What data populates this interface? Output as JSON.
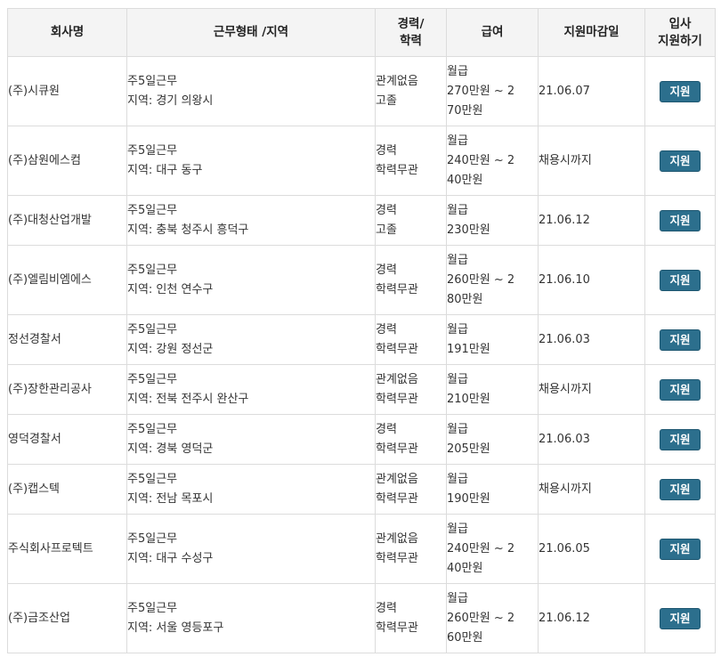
{
  "header": {
    "company": "회사명",
    "work": "근무형태 /지역",
    "career_line1": "경력/",
    "career_line2": "학력",
    "salary": "급여",
    "deadline": "지원마감일",
    "apply_line1": "입사",
    "apply_line2": "지원하기"
  },
  "apply_label": "지원",
  "rows": [
    {
      "company": "(주)시큐원",
      "work": "주5일근무",
      "region": "지역: 경기 의왕시",
      "career": "관계없음",
      "edu": "고졸",
      "salary": [
        "월급",
        "270만원 ~ 2",
        "70만원"
      ],
      "deadline": "21.06.07"
    },
    {
      "company": "(주)삼원에스컴",
      "work": "주5일근무",
      "region": "지역: 대구 동구",
      "career": "경력",
      "edu": "학력무관",
      "salary": [
        "월급",
        "240만원 ~ 2",
        "40만원"
      ],
      "deadline": "채용시까지"
    },
    {
      "company": "(주)대청산업개발",
      "work": "주5일근무",
      "region": "지역: 충북 청주시 흥덕구",
      "career": "경력",
      "edu": "고졸",
      "salary": [
        "월급",
        "230만원"
      ],
      "deadline": "21.06.12"
    },
    {
      "company": "(주)엘림비엠에스",
      "work": "주5일근무",
      "region": "지역: 인천 연수구",
      "career": "경력",
      "edu": "학력무관",
      "salary": [
        "월급",
        "260만원 ~ 2",
        "80만원"
      ],
      "deadline": "21.06.10"
    },
    {
      "company": "정선경찰서",
      "work": "주5일근무",
      "region": "지역: 강원 정선군",
      "career": "경력",
      "edu": "학력무관",
      "salary": [
        "월급",
        "191만원"
      ],
      "deadline": "21.06.03"
    },
    {
      "company": "(주)장한관리공사",
      "work": "주5일근무",
      "region": "지역: 전북 전주시 완산구",
      "career": "관계없음",
      "edu": "학력무관",
      "salary": [
        "월급",
        "210만원"
      ],
      "deadline": "채용시까지"
    },
    {
      "company": "영덕경찰서",
      "work": "주5일근무",
      "region": "지역: 경북 영덕군",
      "career": "경력",
      "edu": "학력무관",
      "salary": [
        "월급",
        "205만원"
      ],
      "deadline": "21.06.03"
    },
    {
      "company": "(주)캡스텍",
      "work": "주5일근무",
      "region": "지역: 전남 목포시",
      "career": "관계없음",
      "edu": "학력무관",
      "salary": [
        "월급",
        "190만원"
      ],
      "deadline": "채용시까지"
    },
    {
      "company": "주식회사프로텍트",
      "work": "주5일근무",
      "region": "지역: 대구 수성구",
      "career": "관계없음",
      "edu": "학력무관",
      "salary": [
        "월급",
        "240만원 ~ 2",
        "40만원"
      ],
      "deadline": "21.06.05"
    },
    {
      "company": "(주)금조산업",
      "work": "주5일근무",
      "region": "지역: 서울 영등포구",
      "career": "경력",
      "edu": "학력무관",
      "salary": [
        "월급",
        "260만원 ~ 2",
        "60만원"
      ],
      "deadline": "21.06.12"
    }
  ]
}
